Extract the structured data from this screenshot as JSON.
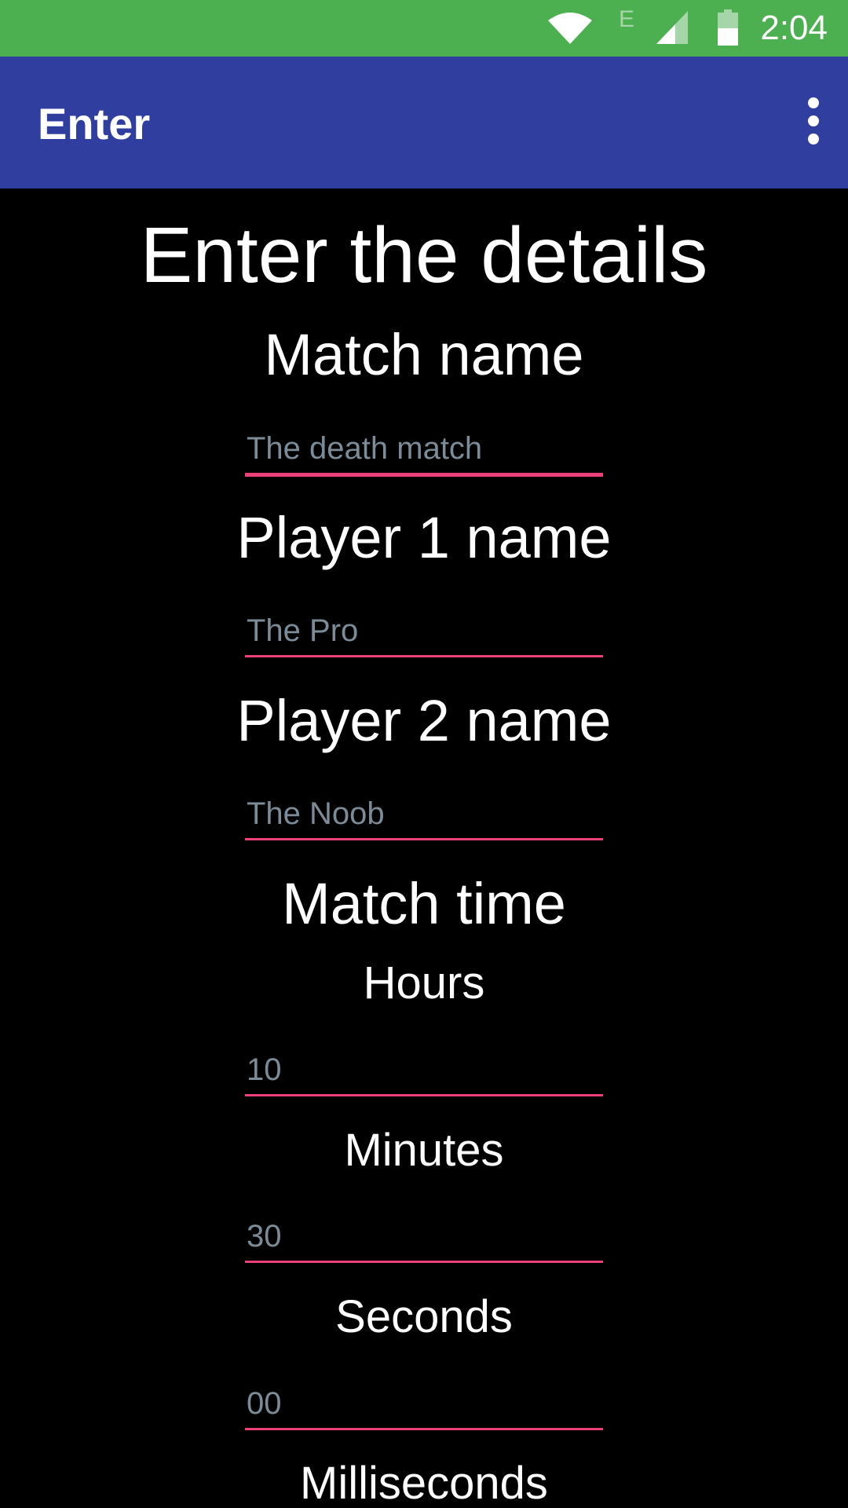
{
  "status_bar": {
    "time": "2:04",
    "network_label": "E",
    "icons": [
      "wifi-icon",
      "signal-icon",
      "battery-icon"
    ],
    "color": "#4CAF50"
  },
  "app_bar": {
    "title": "Enter",
    "menu_icon": "more-vert-icon",
    "color": "#303F9F"
  },
  "form": {
    "heading": "Enter the details",
    "match_name": {
      "label": "Match name",
      "placeholder": "The death match"
    },
    "player1": {
      "label": "Player 1 name",
      "placeholder": "The Pro"
    },
    "player2": {
      "label": "Player 2 name",
      "placeholder": "The Noob"
    },
    "match_time": {
      "label": "Match time",
      "hours": {
        "label": "Hours",
        "placeholder": "10"
      },
      "minutes": {
        "label": "Minutes",
        "placeholder": "30"
      },
      "seconds": {
        "label": "Seconds",
        "placeholder": "00"
      },
      "milliseconds": {
        "label": "Milliseconds"
      }
    }
  },
  "colors": {
    "accent": "#EC407A",
    "background": "#000000",
    "hint": "#7B8B97"
  }
}
